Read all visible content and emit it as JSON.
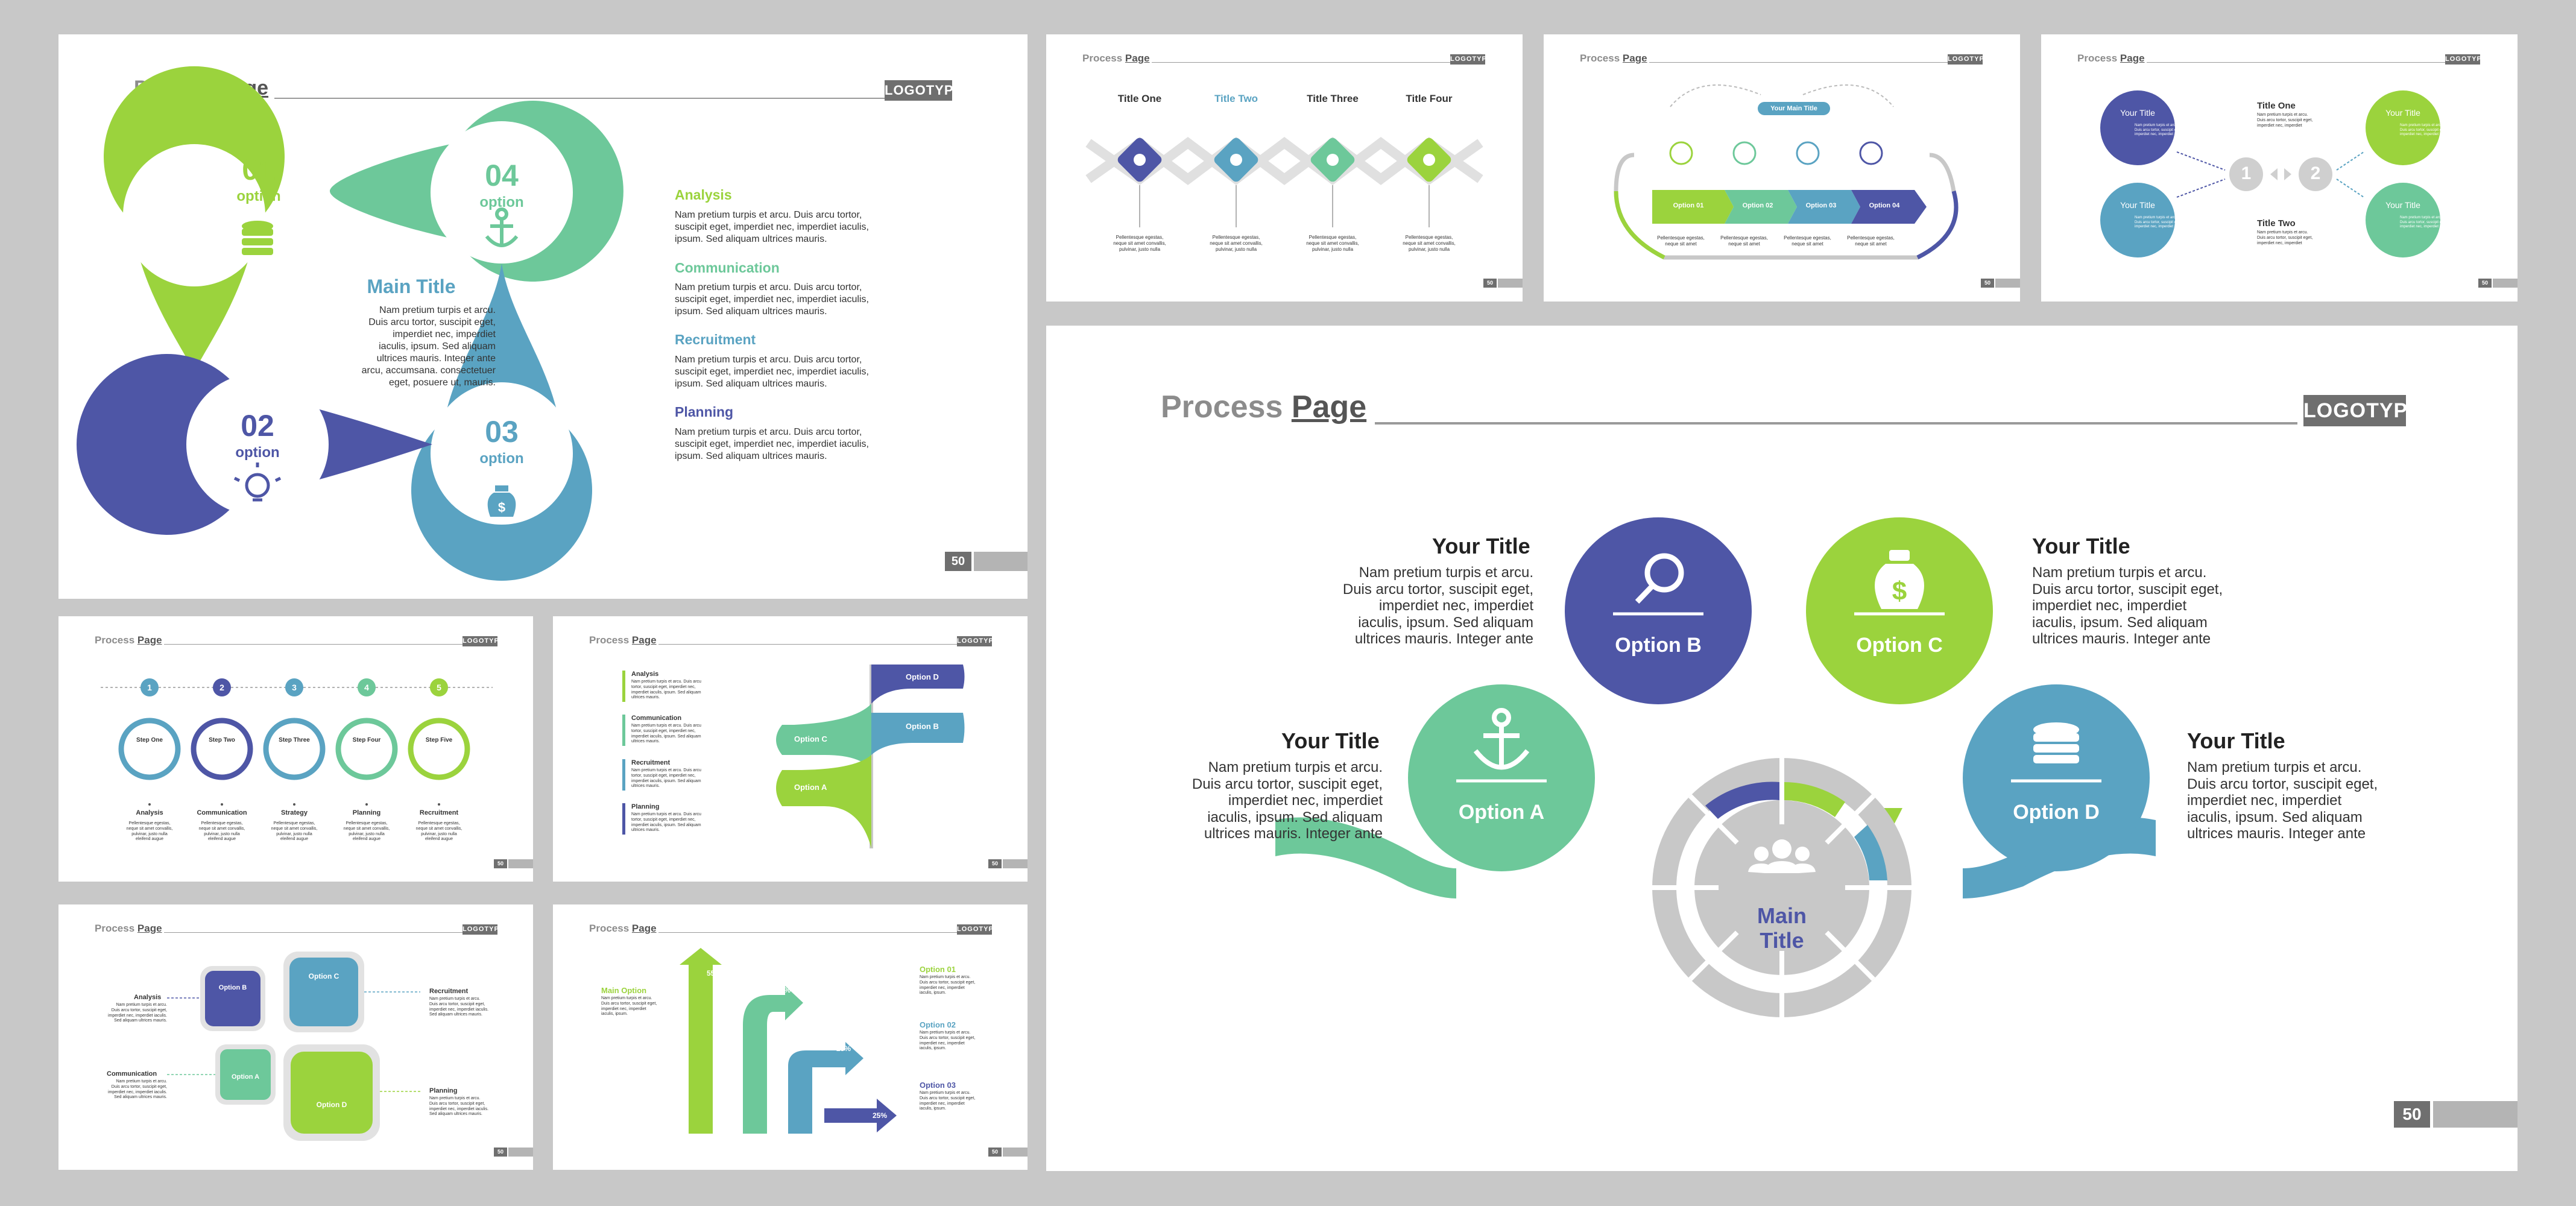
{
  "header": {
    "title_a": "Process",
    "title_b": "Page",
    "logo": "LOGOTYPE",
    "page_number": "50"
  },
  "colors": {
    "lime": "#9bd33d",
    "mint": "#6dc89a",
    "teal": "#5aa3c2",
    "indigo": "#4e56a6",
    "grey": "#c8c8c8"
  },
  "s1": {
    "main_title": "Main Title",
    "main_body": "Nam pretium turpis et arcu.\nDuis arcu tortor, suscipit eget,\nimperdiet nec, imperdiet\niaculis, ipsum. Sed aliquam\nultrices mauris. Integer ante\narcu, accumsana. consectetuer\neget, posuere ut, mauris.",
    "pins": [
      {
        "num": "01",
        "label": "option",
        "icon": "database-icon"
      },
      {
        "num": "04",
        "label": "option",
        "icon": "anchor-icon"
      },
      {
        "num": "02",
        "label": "option",
        "icon": "lightbulb-icon"
      },
      {
        "num": "03",
        "label": "option",
        "icon": "money-bag-icon"
      }
    ],
    "items": [
      {
        "title": "Analysis",
        "body": "Nam pretium turpis et arcu. Duis arcu tortor,\nsuscipit eget, imperdiet nec, imperdiet iaculis,\nipsum. Sed aliquam ultrices mauris."
      },
      {
        "title": "Communication",
        "body": "Nam pretium turpis et arcu. Duis arcu tortor,\nsuscipit eget, imperdiet nec, imperdiet iaculis,\nipsum. Sed aliquam ultrices mauris."
      },
      {
        "title": "Recruitment",
        "body": "Nam pretium turpis et arcu. Duis arcu tortor,\nsuscipit eget, imperdiet nec, imperdiet iaculis,\nipsum. Sed aliquam ultrices mauris."
      },
      {
        "title": "Planning",
        "body": "Nam pretium turpis et arcu. Duis arcu tortor,\nsuscipit eget, imperdiet nec, imperdiet iaculis,\nipsum. Sed aliquam ultrices mauris."
      }
    ]
  },
  "s2": {
    "titles": [
      "Title One",
      "Title Two",
      "Title Three",
      "Title Four"
    ],
    "body": "Pellentesque egestas,\nneque sit amet convallis,\npulvinar, justo nulla"
  },
  "s3": {
    "main": "Your Main Title",
    "options": [
      "Option 01",
      "Option 02",
      "Option 03",
      "Option 04"
    ],
    "body": "Pellentesque egestas,\nneque sit amet"
  },
  "s4": {
    "circle": "Your Title",
    "titles": [
      "Title One",
      "Title Two"
    ],
    "nums": [
      "1",
      "2"
    ],
    "body": "Nam pretium turpis et arcu.\nDuis arcu tortor, suscipit eget,\nimperdiet nec, imperdiet"
  },
  "s5": {
    "steps": [
      "Step One",
      "Step Two",
      "Step Three",
      "Step Four",
      "Step Five"
    ],
    "nums": [
      "1",
      "2",
      "3",
      "4",
      "5"
    ],
    "labels": [
      "Analysis",
      "Communication",
      "Strategy",
      "Planning",
      "Recruitment"
    ],
    "body": "Pellentesque egestas,\nneque sit amet convallis,\npulvinar, justo nulla\neleifend augue"
  },
  "s6": {
    "items": [
      "Analysis",
      "Communication",
      "Recruitment",
      "Planning"
    ],
    "options": [
      "Option D",
      "Option C",
      "Option B",
      "Option A"
    ],
    "body": "Nam pretium turpis et arcu. Duis arcu\ntortor, suscipit eget, imperdiet nec,\nimperdiet iaculis, ipsum. Sed aliquam\nultrices mauris."
  },
  "s7": {
    "options": [
      "Option B",
      "Option C",
      "Option A",
      "Option D"
    ],
    "labels": [
      "Analysis",
      "Recruitment",
      "Communication",
      "Planning"
    ],
    "body": "Nam pretium turpis et arcu.\nDuis arcu tortor, suscipit eget,\nimperdiet nec, imperdiet iaculis.\nSed aliquam ultrices mauris."
  },
  "s8": {
    "main": "Main Option",
    "pcts": [
      "55%",
      "45%",
      "25%",
      "25%"
    ],
    "options": [
      "Option 01",
      "Option 02",
      "Option 03"
    ],
    "body": "Nam pretium turpis et arcu.\nDuis arcu tortor, suscipit eget,\nimperdiet nec, imperdiet\niaculis, ipsum."
  },
  "s9": {
    "main_title": "Main\nTitle",
    "options": [
      "Option A",
      "Option B",
      "Option C",
      "Option D"
    ],
    "your_title": "Your Title",
    "body": "Nam pretium turpis et arcu.\nDuis arcu tortor, suscipit eget,\nimperdiet nec, imperdiet\niaculis, ipsum. Sed aliquam\nultrices mauris. Integer ante"
  }
}
